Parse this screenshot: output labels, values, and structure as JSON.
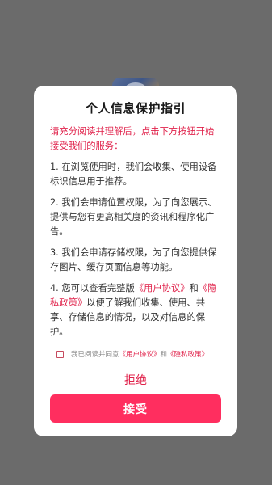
{
  "dialog": {
    "title": "个人信息保护指引",
    "intro": "请充分阅读并理解后，点击下方按钮开始接受我们的服务：",
    "item1": "1. 在浏览使用时，我们会收集、使用设备标识信息用于推荐。",
    "item2": "2. 我们会申请位置权限，为了向您展示、提供与您有更高相关度的资讯和程序化广告。",
    "item3": "3. 我们会申请存储权限，为了向您提供保存图片、缓存页面信息等功能。",
    "item4_prefix": "4. 您可以查看完整版",
    "user_agreement": "《用户协议》",
    "and": "和",
    "privacy_policy": "《隐私政策》",
    "item4_suffix": "以便了解我们收集、使用、共享、存储信息的情况，以及对信息的保护。",
    "agree_prefix": "我已阅读并同意",
    "agree_user_agreement": "《用户协议》",
    "agree_and": "和",
    "agree_privacy_policy": "《隐私政策》",
    "reject_label": "拒绝",
    "accept_label": "接受"
  },
  "colors": {
    "overlay": "#6b6b6b",
    "accent": "#e0214a",
    "button": "#ff2e5f"
  },
  "icons": {
    "background_app": "app-logo-icon"
  }
}
